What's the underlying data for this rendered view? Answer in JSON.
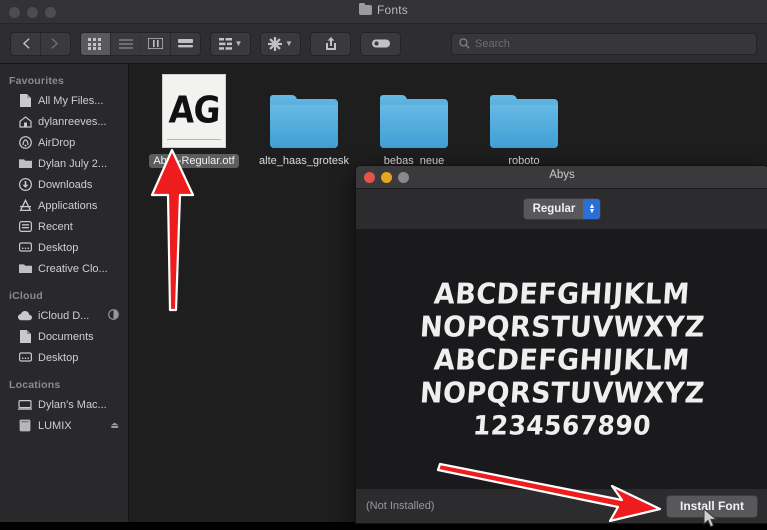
{
  "finder": {
    "title": "Fonts",
    "title_icon": "folder-icon",
    "traffic_lights": [
      "close-button",
      "minimize-button",
      "zoom-button"
    ],
    "toolbar": {
      "back_icon": "chevron-left-icon",
      "forward_icon": "chevron-right-icon",
      "view_icon_grid": "icon-view-icon",
      "view_list": "list-view-icon",
      "view_column": "column-view-icon",
      "view_coverflow": "coverflow-view-icon",
      "arrange_icon": "arrange-by-icon",
      "action_icon": "gear-icon",
      "share_icon": "share-icon",
      "tag_icon": "tag-icon",
      "chevron_icon": "chevron-down-icon"
    },
    "search": {
      "icon": "search-icon",
      "placeholder": "Search",
      "value": ""
    },
    "sidebar": {
      "sections": [
        {
          "header": "Favourites",
          "items": [
            {
              "label": "All My Files...",
              "icon": "document-icon"
            },
            {
              "label": "dylanreeves...",
              "icon": "home-icon"
            },
            {
              "label": "AirDrop",
              "icon": "airdrop-icon"
            },
            {
              "label": "Dylan July 2...",
              "icon": "folder-icon"
            },
            {
              "label": "Downloads",
              "icon": "downloads-icon"
            },
            {
              "label": "Applications",
              "icon": "applications-icon"
            },
            {
              "label": "Recent",
              "icon": "recent-icon"
            },
            {
              "label": "Desktop",
              "icon": "desktop-icon"
            },
            {
              "label": "Creative Clo...",
              "icon": "folder-icon"
            }
          ]
        },
        {
          "header": "iCloud",
          "items": [
            {
              "label": "iCloud D...",
              "icon": "icloud-icon",
              "accessory": "progress-icon"
            },
            {
              "label": "Documents",
              "icon": "documents-icon"
            },
            {
              "label": "Desktop",
              "icon": "desktop-icon"
            }
          ]
        },
        {
          "header": "Locations",
          "items": [
            {
              "label": "Dylan's Mac...",
              "icon": "computer-icon"
            },
            {
              "label": "LUMIX",
              "icon": "drive-icon",
              "accessory": "eject-icon"
            }
          ]
        }
      ]
    },
    "files": [
      {
        "name": "Abys-Regular.otf",
        "type": "font-file",
        "thumb_text": "AG",
        "selected": true
      },
      {
        "name": "alte_haas_grotesk",
        "type": "folder",
        "selected": false
      },
      {
        "name": "bebas_neue",
        "type": "folder",
        "selected": false
      },
      {
        "name": "roboto",
        "type": "folder",
        "selected": false
      }
    ]
  },
  "font_preview": {
    "title": "Abys",
    "traffic_lights": [
      "close-button",
      "minimize-button",
      "zoom-button"
    ],
    "style_popup": {
      "value": "Regular",
      "stepper_icon": "up-down-chevron-icon"
    },
    "specimen_lines": [
      "ABCDEFGHIJKLM",
      "NOPQRSTUVWXYZ",
      "ABCDEFGHIJKLM",
      "NOPQRSTUVWXYZ",
      "1234567890"
    ],
    "status": "(Not Installed)",
    "install_button": "Install Font"
  },
  "annotations": {
    "arrow_color": "#ee1c1c",
    "arrow_outline": "#ffffff",
    "arrows": [
      {
        "name": "arrow-to-font-file",
        "points_to": "Abys-Regular.otf"
      },
      {
        "name": "arrow-to-install-button",
        "points_to": "Install Font"
      }
    ],
    "cursor": "mouse-pointer"
  },
  "colors": {
    "window_chrome": "#333335",
    "sidebar_bg": "#29292b",
    "content_bg": "#1e1e1e",
    "specimen_bg": "#1a1a1c",
    "accent_blue": "#2b6ed6",
    "folder_blue": "#4fabdc"
  }
}
